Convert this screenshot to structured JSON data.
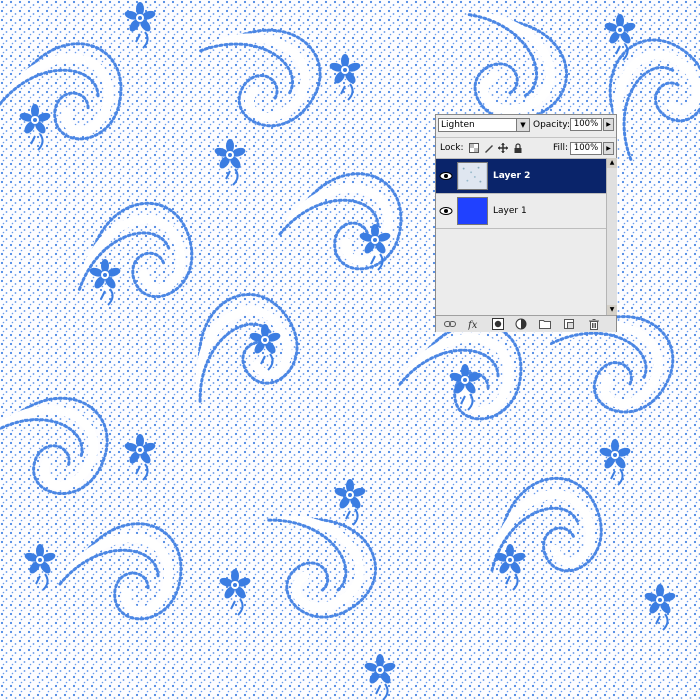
{
  "layers_panel": {
    "blend_mode": "Lighten",
    "opacity_label": "Opacity:",
    "opacity_value": "100%",
    "lock_label": "Lock:",
    "fill_label": "Fill:",
    "fill_value": "100%",
    "layers": [
      {
        "name": "Layer 2",
        "selected": true,
        "visible": true
      },
      {
        "name": "Layer 1",
        "selected": false,
        "visible": true
      }
    ],
    "bottom_icons": [
      "link-icon",
      "fx-icon",
      "mask-icon",
      "adjustment-icon",
      "folder-icon",
      "new-layer-icon",
      "trash-icon"
    ]
  },
  "colors": {
    "pattern_blue": "#3a7be0",
    "layer1_fill": "#2041ff",
    "selection": "#0a246a",
    "panel_bg": "#ececec"
  }
}
